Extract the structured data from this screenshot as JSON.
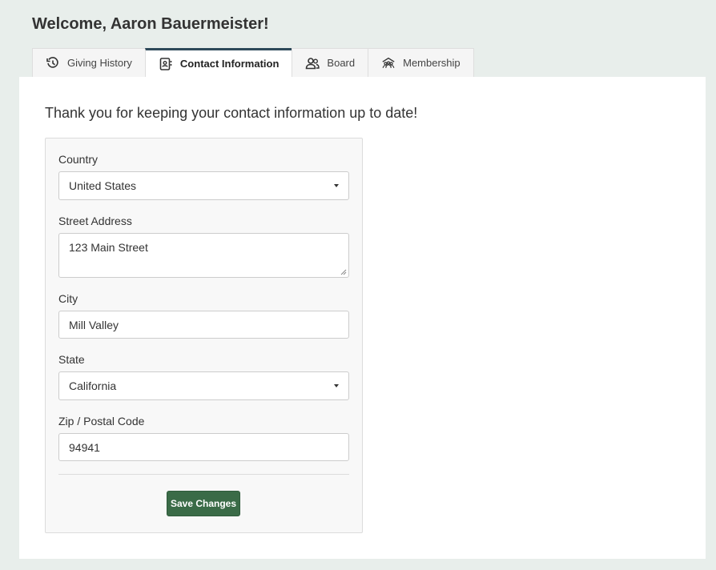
{
  "header": {
    "welcome": "Welcome, Aaron Bauermeister!"
  },
  "tabs": [
    {
      "label": "Giving History",
      "icon": "history-icon",
      "active": false
    },
    {
      "label": "Contact Information",
      "icon": "contact-card-icon",
      "active": true
    },
    {
      "label": "Board",
      "icon": "people-icon",
      "active": false
    },
    {
      "label": "Membership",
      "icon": "community-icon",
      "active": false
    }
  ],
  "main": {
    "intro": "Thank you for keeping your contact information up to date!",
    "form": {
      "country": {
        "label": "Country",
        "value": "United States"
      },
      "street": {
        "label": "Street Address",
        "value": "123 Main Street"
      },
      "city": {
        "label": "City",
        "value": "Mill Valley"
      },
      "state": {
        "label": "State",
        "value": "California"
      },
      "zip": {
        "label": "Zip / Postal Code",
        "value": "94941"
      },
      "save_label": "Save Changes"
    }
  },
  "colors": {
    "accent_button": "#3a6b47",
    "active_tab_border": "#2e4a5a",
    "page_bg": "#e8eeeb"
  }
}
